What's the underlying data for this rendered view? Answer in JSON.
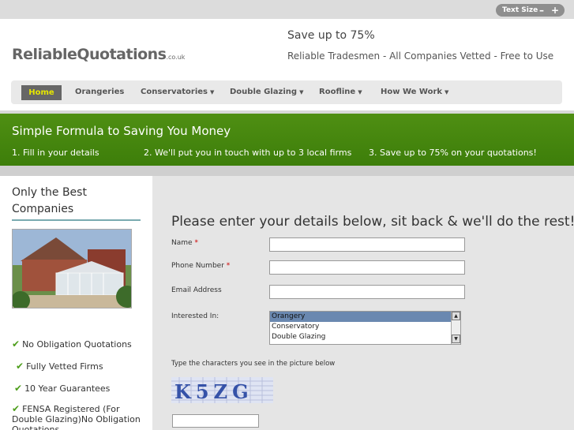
{
  "top_bar": {
    "text_size_label": "Text Size",
    "decrease": "–",
    "increase": "+"
  },
  "logo": {
    "name": "ReliableQuotations",
    "suffix": ".co.uk"
  },
  "header": {
    "tagline": "Save up to 75%",
    "subtagline": "Reliable Tradesmen  - All Companies Vetted - Free to Use"
  },
  "nav": {
    "items": [
      {
        "label": "Home",
        "active": true
      },
      {
        "label": "Orangeries"
      },
      {
        "label": "Conservatories",
        "dropdown": true
      },
      {
        "label": "Double Glazing",
        "dropdown": true
      },
      {
        "label": "Roofline",
        "dropdown": true
      },
      {
        "label": "How We Work",
        "dropdown": true
      }
    ]
  },
  "banner": {
    "title": "Simple Formula to Saving You Money",
    "steps": [
      "1. Fill in your details",
      "2. We'll put you in touch with up to 3 local firms",
      "3. Save up to 75% on your quotations!"
    ]
  },
  "sidebar": {
    "title": "Only the Best Companies",
    "features": [
      "No Obligation Quotations",
      "Fully Vetted Firms",
      "10 Year Guarantees",
      "FENSA Registered (For Double Glazing)No Obligation Quotations"
    ]
  },
  "form": {
    "heading": "Please enter your details below, sit back & we'll do the rest!",
    "name_label": "Name",
    "phone_label": "Phone Number",
    "email_label": "Email Address",
    "required_mark": "*",
    "interested_label": "Interested In:",
    "options": [
      "Orangery",
      "Conservatory",
      "Double Glazing"
    ],
    "captcha_label": "Type the characters you see in the picture below",
    "captcha_text": "K5ZG"
  },
  "colors": {
    "banner_green": "#4a8a10",
    "nav_active_bg": "#666666",
    "nav_active_text": "#e6e600",
    "tick_green": "#4d9e1b"
  }
}
